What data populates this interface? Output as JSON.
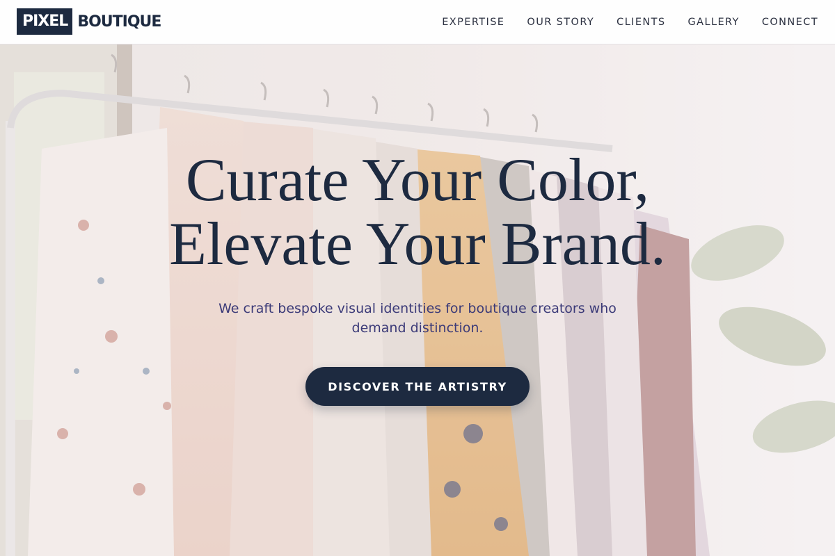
{
  "header": {
    "logo": {
      "mark": "PIXEL",
      "word": "BOUTIQUE"
    },
    "nav": [
      {
        "label": "EXPERTISE"
      },
      {
        "label": "OUR STORY"
      },
      {
        "label": "CLIENTS"
      },
      {
        "label": "GALLERY"
      },
      {
        "label": "CONNECT"
      }
    ]
  },
  "hero": {
    "title_line1": "Curate Your Color,",
    "title_line2": "Elevate Your Brand.",
    "subtitle": "We craft bespoke visual identities for boutique creators who demand distinction.",
    "cta_label": "DISCOVER THE ARTISTRY",
    "background_image": "clothing-rack-photo"
  },
  "colors": {
    "primary_navy": "#1d2a40",
    "subtitle_indigo": "#3b3a78",
    "header_bg": "#ffffff"
  }
}
